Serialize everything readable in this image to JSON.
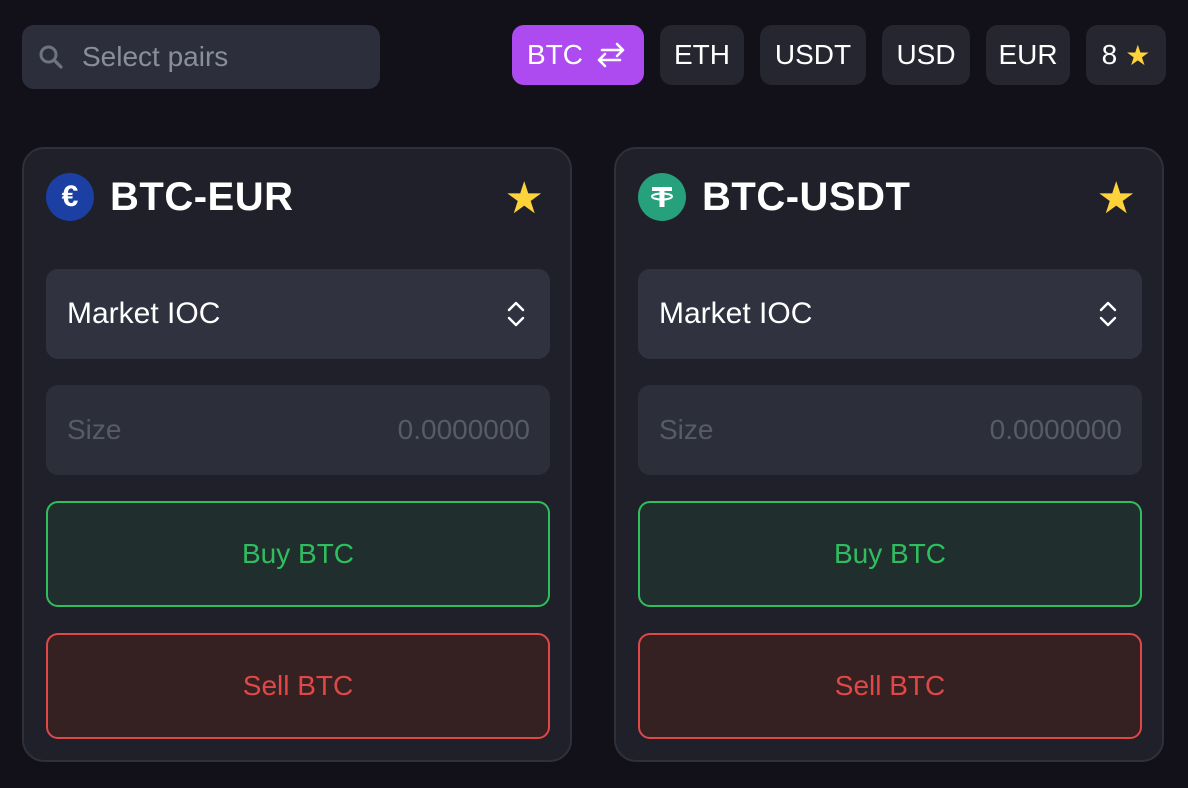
{
  "search": {
    "placeholder": "Select pairs"
  },
  "filters": [
    {
      "label": "BTC",
      "active": true,
      "icon": "swap-arrows-icon"
    },
    {
      "label": "ETH",
      "active": false
    },
    {
      "label": "USDT",
      "active": false
    },
    {
      "label": "USD",
      "active": false
    },
    {
      "label": "EUR",
      "active": false
    },
    {
      "label": "8",
      "active": false,
      "icon": "star-icon"
    }
  ],
  "cards": [
    {
      "pair": "BTC-EUR",
      "coin_icon": "euro-icon",
      "coin_color": "#1b3fa3",
      "favorite": true,
      "order_type": "Market IOC",
      "size_label": "Size",
      "size_value": "0.0000000",
      "buy_label": "Buy BTC",
      "sell_label": "Sell BTC"
    },
    {
      "pair": "BTC-USDT",
      "coin_icon": "tether-icon",
      "coin_color": "#26a17b",
      "favorite": true,
      "order_type": "Market IOC",
      "size_label": "Size",
      "size_value": "0.0000000",
      "buy_label": "Buy BTC",
      "sell_label": "Sell BTC"
    }
  ],
  "colors": {
    "accent": "#ad4af0",
    "star": "#fdd23a",
    "buy": "#2fbe5e",
    "sell": "#e04848",
    "background": "#12111a"
  }
}
